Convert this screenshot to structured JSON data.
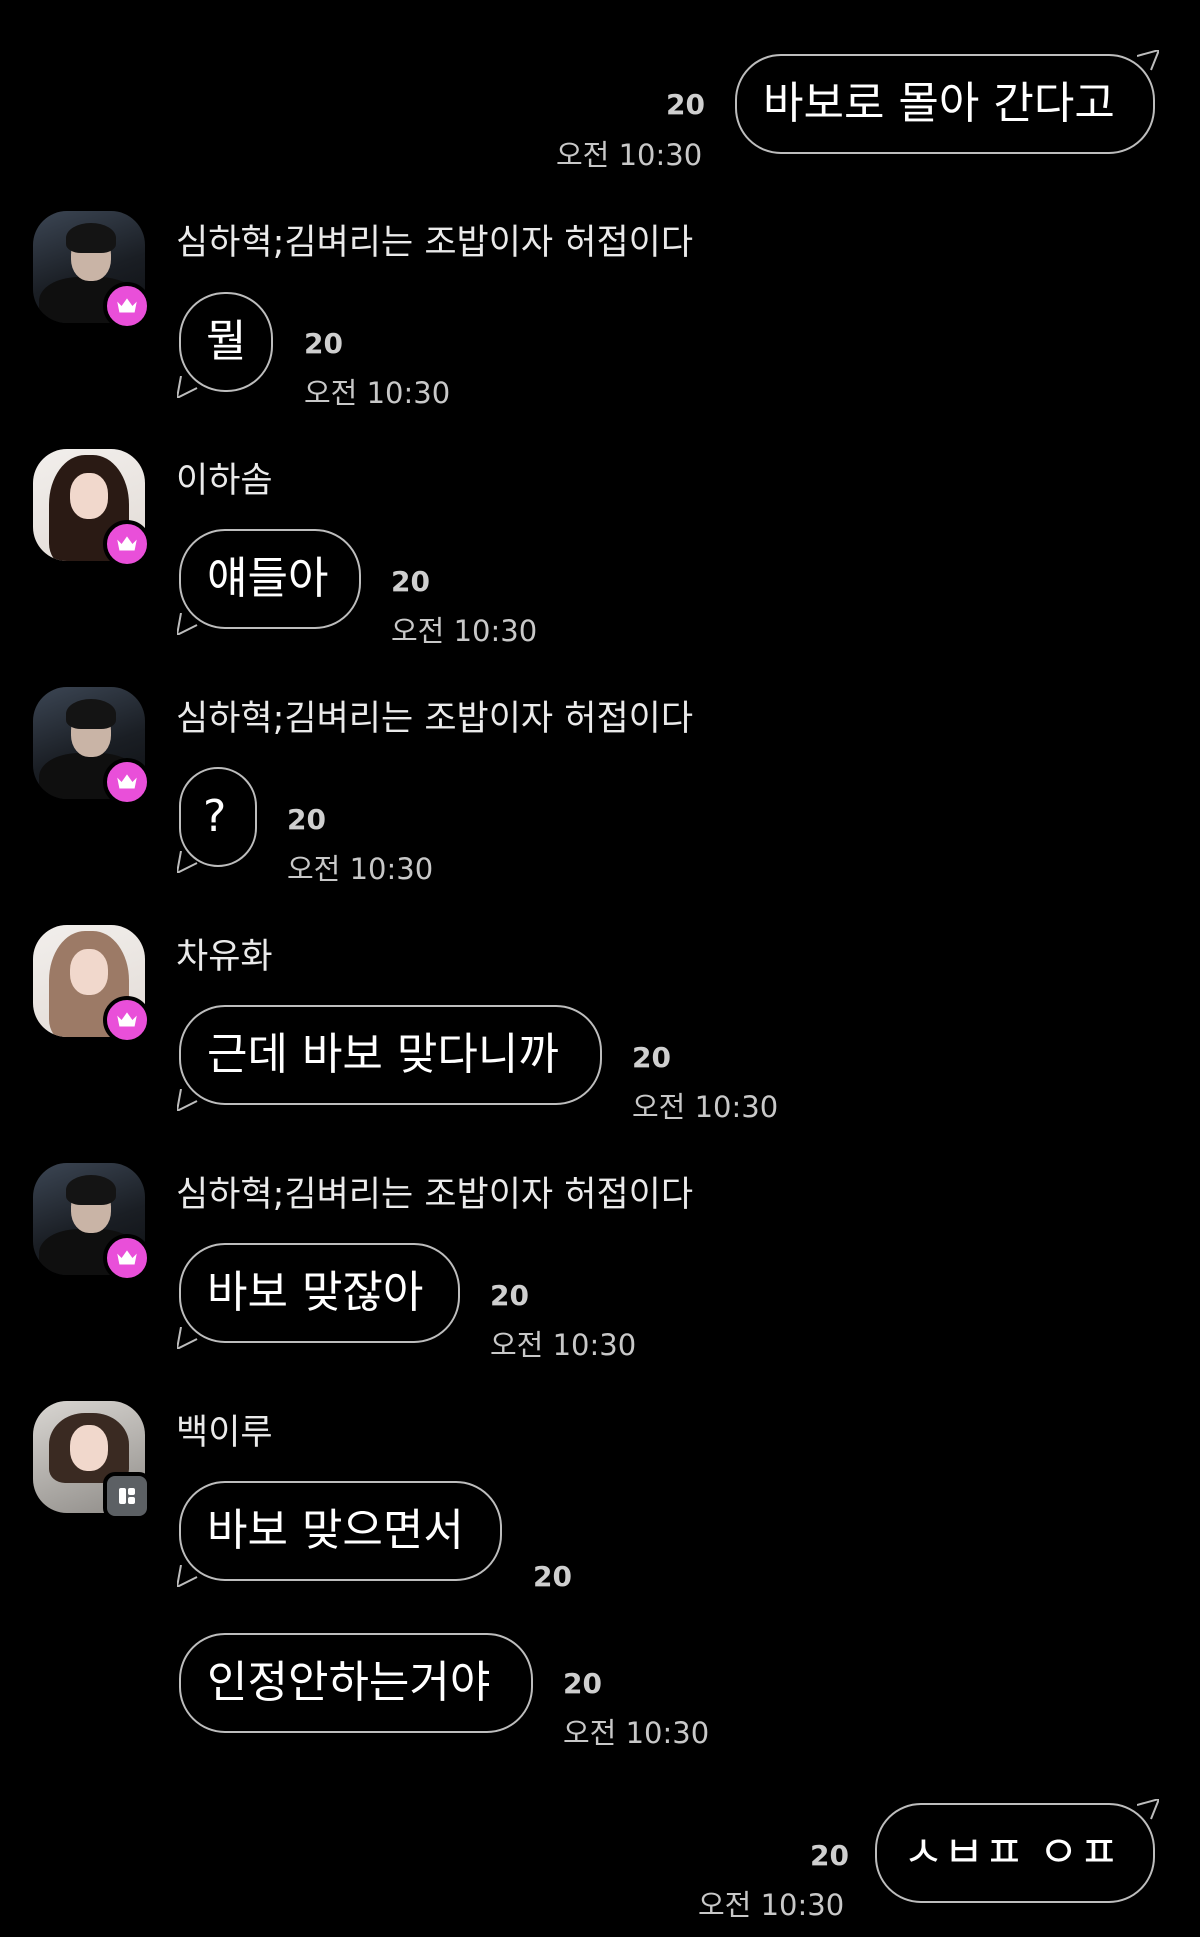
{
  "colors": {
    "background": "#000000",
    "bubble_border": "#bdbdbd",
    "crown_badge": "#e94fd9",
    "gray_badge": "#5c6064"
  },
  "messages": [
    {
      "type": "outgoing",
      "text": "바보로 몰아 간다고",
      "count": "20",
      "time": "오전 10:30"
    },
    {
      "type": "incoming",
      "sender": "심하혁;김벼리는 조밥이자 허접이다",
      "avatar_icon": "avatar-boy-black-hoodie",
      "badge_icon": "crown-icon",
      "text": "뭘",
      "count": "20",
      "time": "오전 10:30"
    },
    {
      "type": "incoming",
      "sender": "이하솜",
      "avatar_icon": "avatar-girl-dark-hair",
      "badge_icon": "crown-icon",
      "text": "얘들아",
      "count": "20",
      "time": "오전 10:30"
    },
    {
      "type": "incoming",
      "sender": "심하혁;김벼리는 조밥이자 허접이다",
      "avatar_icon": "avatar-boy-black-hoodie",
      "badge_icon": "crown-icon",
      "text": "?",
      "count": "20",
      "time": "오전 10:30"
    },
    {
      "type": "incoming",
      "sender": "차유화",
      "avatar_icon": "avatar-girl-light-hair",
      "badge_icon": "crown-icon",
      "text": "근데 바보 맞다니까",
      "count": "20",
      "time": "오전 10:30"
    },
    {
      "type": "incoming",
      "sender": "심하혁;김벼리는 조밥이자 허접이다",
      "avatar_icon": "avatar-boy-black-hoodie",
      "badge_icon": "crown-icon",
      "text": "바보 맞잖아",
      "count": "20",
      "time": "오전 10:30"
    },
    {
      "type": "incoming",
      "sender": "백이루",
      "avatar_icon": "avatar-girl-bun",
      "badge_icon": "app-icon",
      "text": "바보 맞으면서",
      "count": "20",
      "time": ""
    },
    {
      "type": "incoming-continued",
      "text": "인정안하는거야",
      "count": "20",
      "time": "오전 10:30"
    },
    {
      "type": "outgoing",
      "text": "ㅅㅂㅍ ㅇㅍ",
      "count": "20",
      "time": "오전 10:30"
    }
  ]
}
